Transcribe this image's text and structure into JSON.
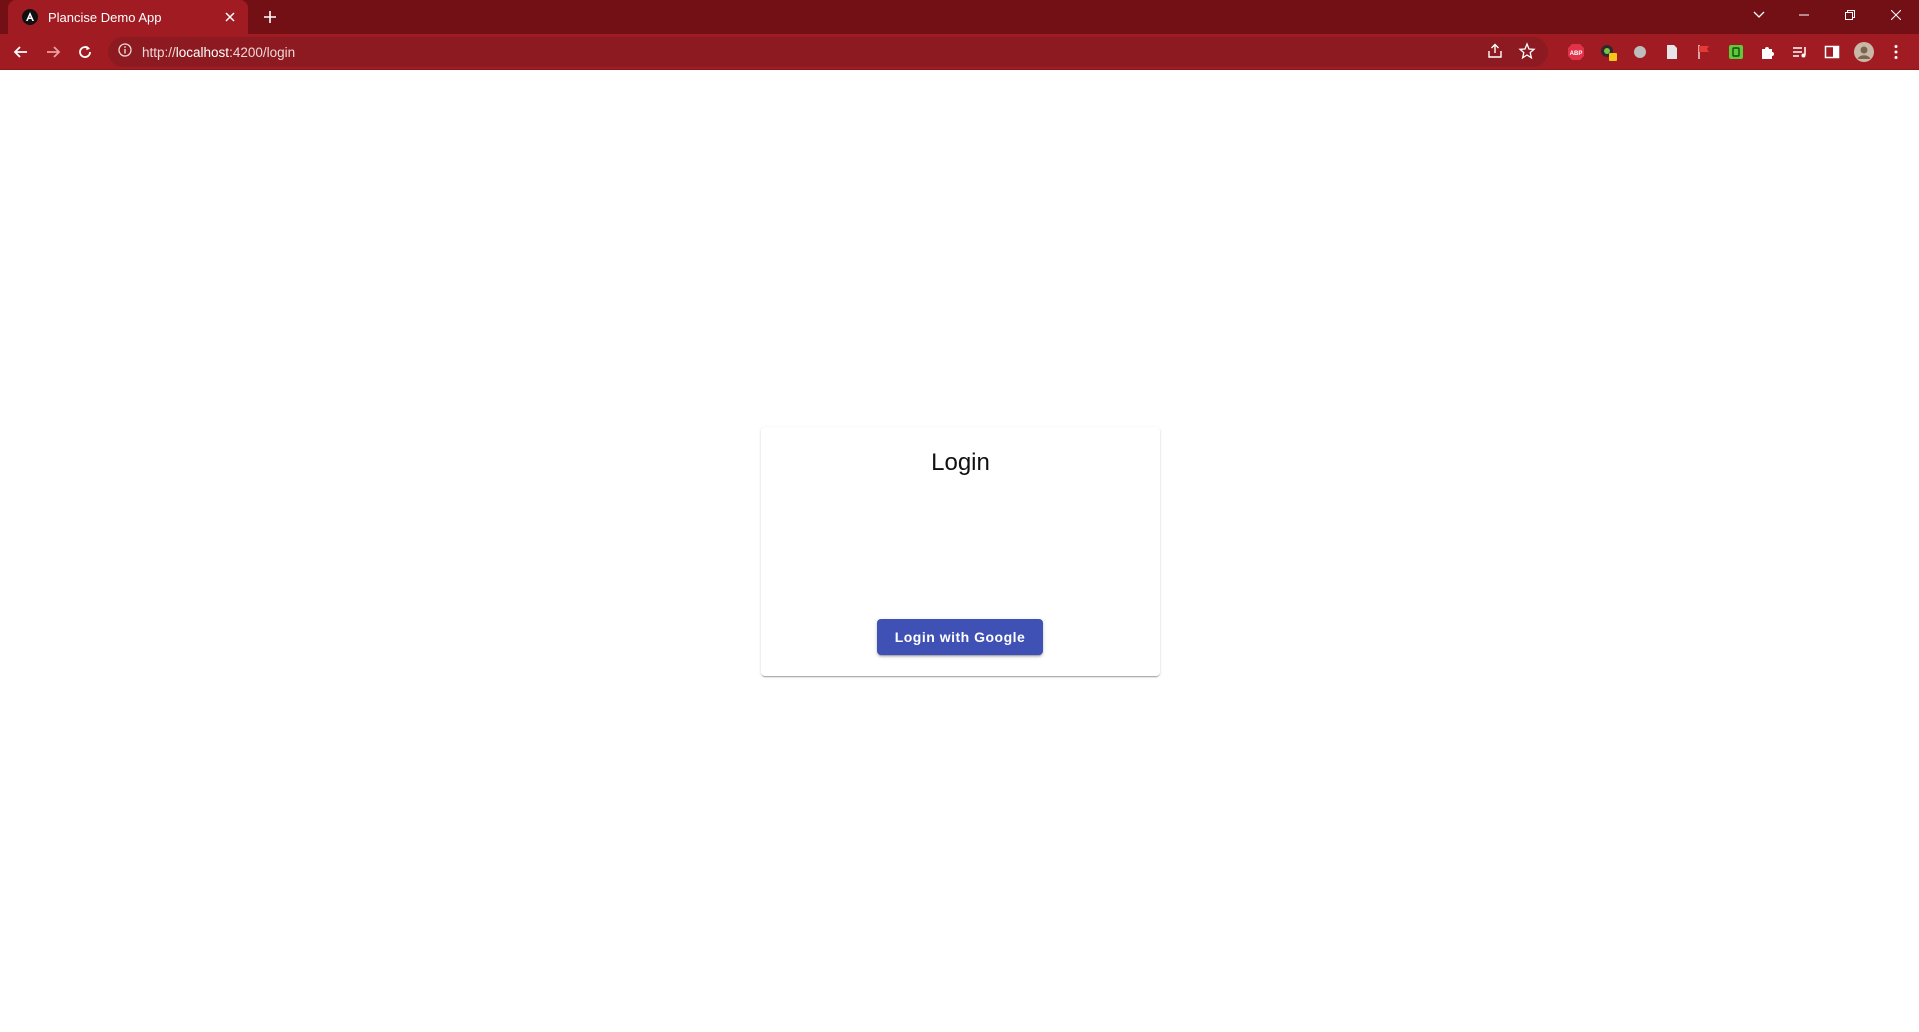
{
  "browser": {
    "tab": {
      "title": "Plancise Demo App",
      "favicon": "angular-icon"
    },
    "address_bar": {
      "scheme": "http://",
      "host": "localhost",
      "path": ":4200/login"
    },
    "theme_color": "#a11c22",
    "titlebar_color": "#721015"
  },
  "page": {
    "card": {
      "title": "Login",
      "button_label": "Login with Google"
    },
    "accent_color": "#3f51b5"
  }
}
